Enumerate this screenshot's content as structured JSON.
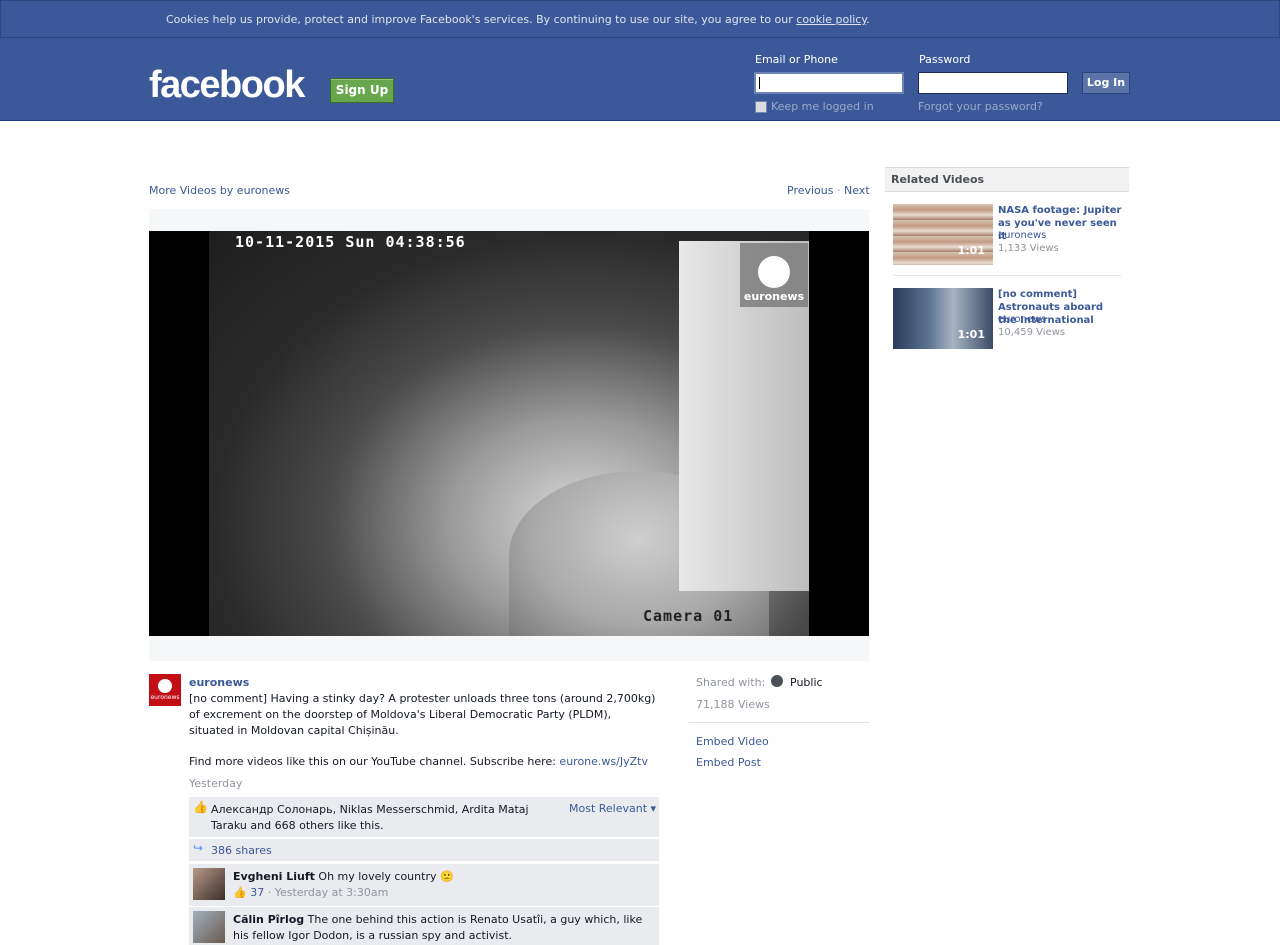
{
  "cookie_banner": {
    "text": "Cookies help us provide, protect and improve Facebook's services. By continuing to use our site, you agree to our ",
    "link": "cookie policy",
    "end": "."
  },
  "header": {
    "logo": "facebook",
    "signup": "Sign Up",
    "email_label": "Email or Phone",
    "password_label": "Password",
    "login": "Log In",
    "keep_logged_in": "Keep me logged in",
    "forgot": "Forgot your password?"
  },
  "video_nav": {
    "more": "More Videos by euronews",
    "previous": "Previous",
    "separator": "·",
    "next": "Next"
  },
  "video": {
    "timestamp": "10-11-2015 Sun 04:38:56",
    "camera": "Camera 01",
    "watermark": "euronews"
  },
  "post": {
    "avatar_text": "euronews",
    "author": "euronews",
    "description": "[no comment] Having a stinky day? A protester unloads three tons (around 2,700kg) of excrement on the doorstep of Moldova's Liberal Democratic Party (PLDM), situated in Moldovan capital Chișinău.",
    "find_more": "Find more videos like this on our YouTube channel. Subscribe here: ",
    "find_link": "eurone.ws/JyZtv",
    "time": "Yesterday",
    "likes": "Александр Солонарь, Niklas Messerschmid, Ardita Mataj Taraku and 668 others like this.",
    "most_relevant": "Most Relevant ▾",
    "shares": "386 shares"
  },
  "comments": [
    {
      "name": "Evgheni Liuft",
      "text": " Oh my lovely country 🙁",
      "likes": "37",
      "time": " · Yesterday at 3:30am"
    },
    {
      "name": "Călin Pîrlog",
      "text": " The one behind this action is Renato Usatîi, a guy which, like his fellow Igor Dodon, is a russian spy and activist."
    }
  ],
  "meta": {
    "shared_with": "Shared with:",
    "audience": "Public",
    "views": "71,188 Views",
    "embed_video": "Embed Video",
    "embed_post": "Embed Post"
  },
  "related": {
    "heading": "Related Videos",
    "items": [
      {
        "title": "NASA footage: Jupiter as you've never seen it",
        "source": "euronews",
        "views": "1,133 Views",
        "duration": "1:01"
      },
      {
        "title": "[no comment] Astronauts aboard the International",
        "source": "euronews",
        "views": "10,459 Views",
        "duration": "1:01"
      }
    ]
  }
}
